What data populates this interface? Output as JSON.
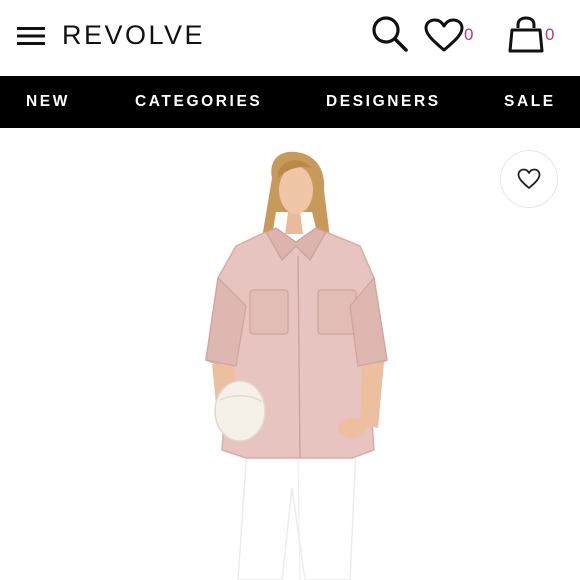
{
  "header": {
    "logo": "REVOLVE",
    "wishlist_count": "0",
    "bag_count": "0",
    "icons": [
      "menu-icon",
      "search-icon",
      "heart-icon",
      "shopping-bag-icon"
    ],
    "accent_color": "#b03a8e"
  },
  "nav": {
    "items": [
      {
        "label": "NEW"
      },
      {
        "label": "CATEGORIES"
      },
      {
        "label": "DESIGNERS"
      },
      {
        "label": "SALE"
      }
    ],
    "background": "#000000"
  },
  "product": {
    "favorite_icon": "heart-outline-icon",
    "shirt_color": "#e7c4bf"
  }
}
